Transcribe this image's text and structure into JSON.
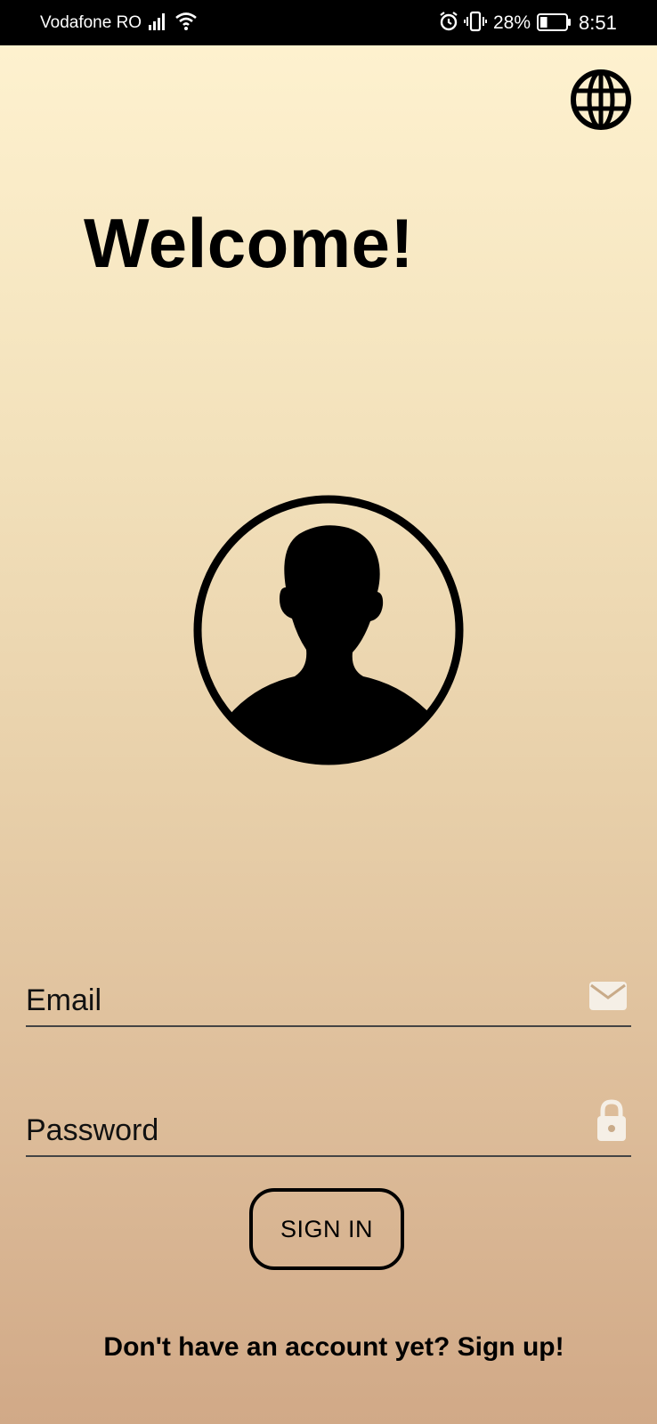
{
  "status_bar": {
    "carrier": "Vodafone RO",
    "battery_percent": "28%",
    "battery_level": 0.28,
    "time": "8:51",
    "icons": [
      "signal-icon",
      "wifi-icon",
      "alarm-icon",
      "vibrate-icon",
      "battery-icon"
    ]
  },
  "header": {
    "language_icon": "globe-icon"
  },
  "main": {
    "title": "Welcome!",
    "avatar_icon": "user-silhouette-icon"
  },
  "form": {
    "email": {
      "placeholder": "Email",
      "value": "",
      "icon": "mail-icon"
    },
    "password": {
      "placeholder": "Password",
      "value": "",
      "icon": "lock-icon"
    },
    "submit_label": "SIGN IN"
  },
  "footer": {
    "signup_text": "Don't have an account yet? Sign up!"
  },
  "colors": {
    "gradient_top": "#fff3d1",
    "gradient_bottom": "#d1a987",
    "accent": "#000000",
    "field_icon": "#f5efe6"
  }
}
